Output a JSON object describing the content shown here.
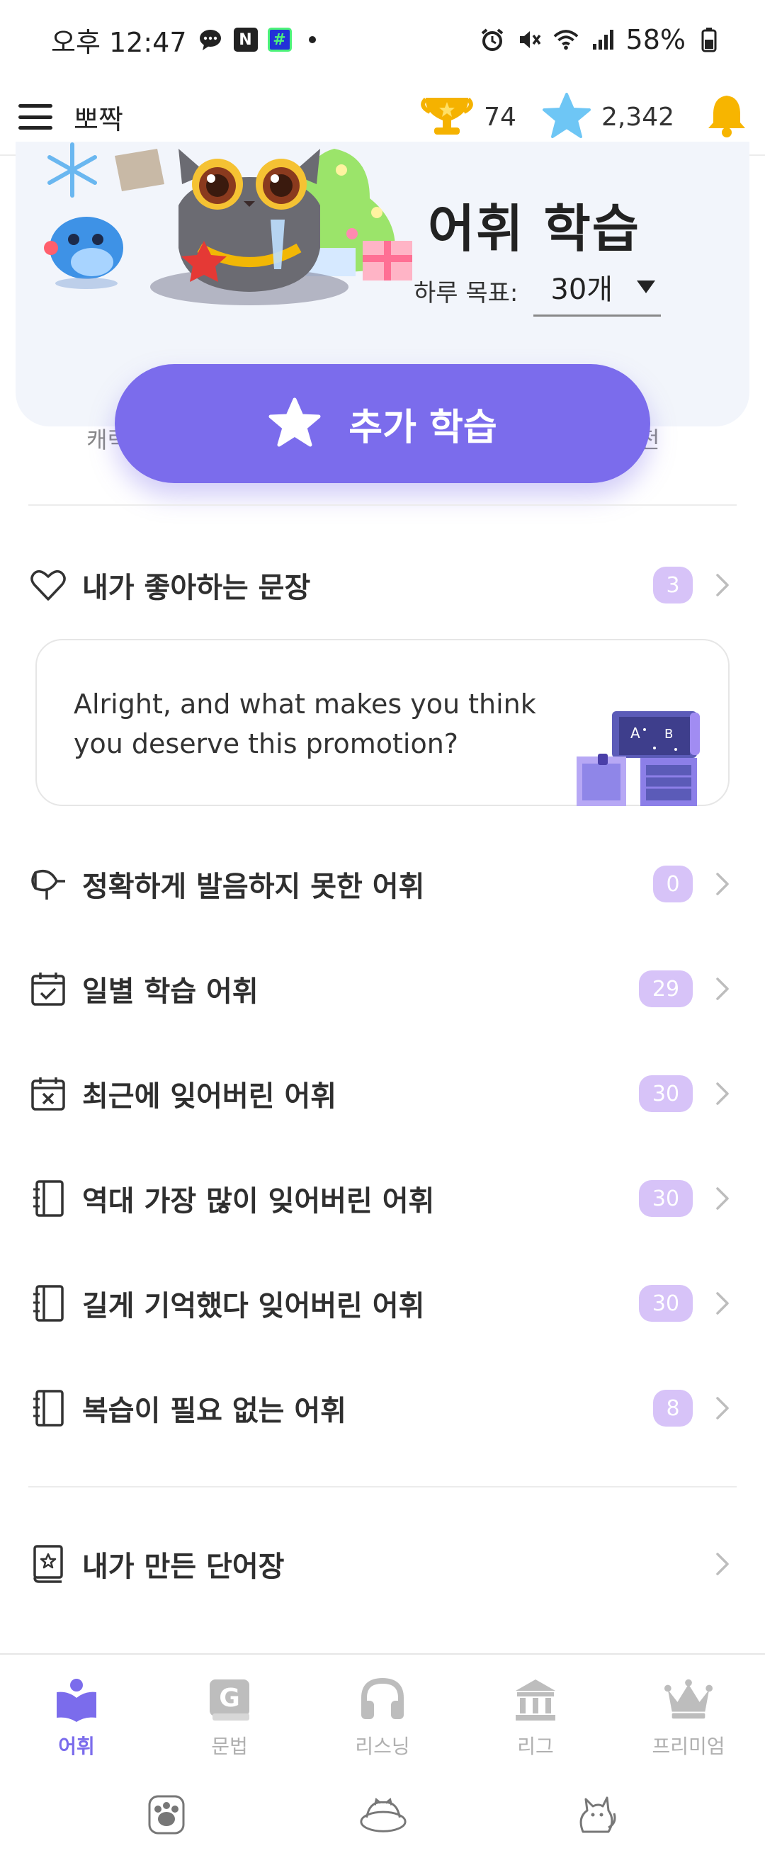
{
  "status_bar": {
    "time": "오후 12:47",
    "notif_n": "N",
    "notif_hash": "#",
    "battery": "58%"
  },
  "header": {
    "title": "뽀짝",
    "trophy_count": "74",
    "star_count": "2,342"
  },
  "hero": {
    "title": "어휘 학습",
    "goal_label": "하루 목표:",
    "goal_value": "30개",
    "peek_left": "캐릭",
    "peek_right": "전"
  },
  "extra_study": {
    "label": "추가 학습"
  },
  "favorites": {
    "label": "내가 좋아하는 문장",
    "count": "3",
    "sentence": "Alright, and what makes you think you deserve this promotion?"
  },
  "word_lists": [
    {
      "label": "정확하게 발음하지 못한 어휘",
      "count": "0",
      "icon": "pronunciation-icon"
    },
    {
      "label": "일별 학습 어휘",
      "count": "29",
      "icon": "calendar-check-icon"
    },
    {
      "label": "최근에 잊어버린 어휘",
      "count": "30",
      "icon": "calendar-x-icon"
    },
    {
      "label": "역대 가장 많이 잊어버린 어휘",
      "count": "30",
      "icon": "notebook-icon"
    },
    {
      "label": "길게 기억했다 잊어버린 어휘",
      "count": "30",
      "icon": "notebook-icon"
    },
    {
      "label": "복습이 필요 없는 어휘",
      "count": "8",
      "icon": "notebook-icon"
    }
  ],
  "my_wordbook": {
    "label": "내가 만든 단어장"
  },
  "bottom_nav": {
    "tabs": [
      {
        "label": "어휘",
        "icon": "book-icon",
        "active": true
      },
      {
        "label": "문법",
        "icon": "grammar-g-icon",
        "active": false
      },
      {
        "label": "리스닝",
        "icon": "headphones-icon",
        "active": false
      },
      {
        "label": "리그",
        "icon": "league-building-icon",
        "active": false
      },
      {
        "label": "프리미엄",
        "icon": "crown-icon",
        "active": false
      }
    ]
  },
  "colors": {
    "accent": "#7b6cec",
    "badge": "#d7c3f8",
    "trophy": "#f5b200",
    "star": "#6ec6f5",
    "bell": "#f7b500"
  }
}
